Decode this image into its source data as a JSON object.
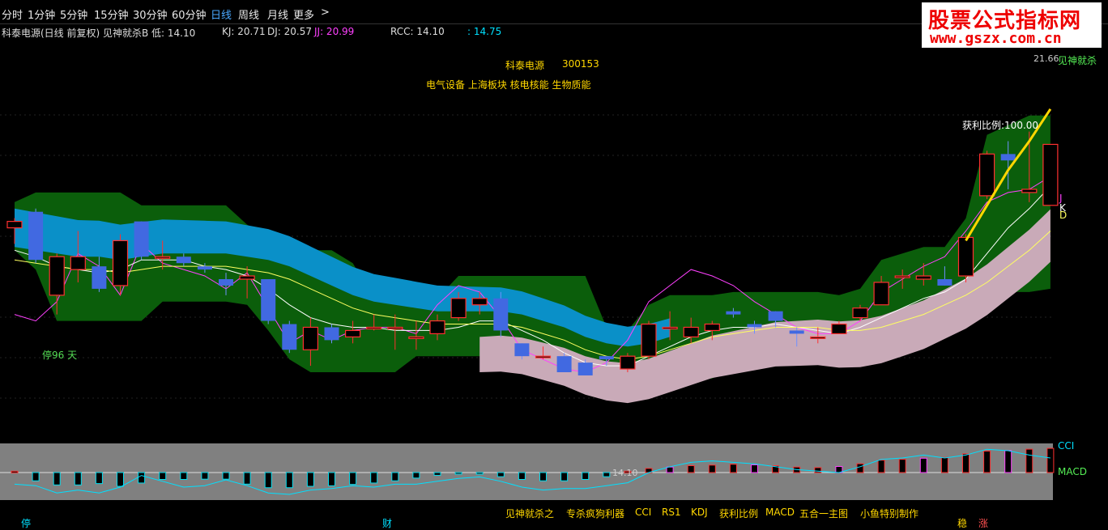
{
  "periods": [
    "分时",
    "1分钟",
    "5分钟",
    "15分钟",
    "30分钟",
    "60分钟",
    "日线",
    "周线",
    "月线",
    "更多"
  ],
  "active_period": "日线",
  "more_arrow": ">",
  "info": {
    "title": "科泰电源(日线 前复权) 见神就杀B 低: 14.10",
    "kj": "KJ: 20.71",
    "dj": "DJ: 20.57",
    "jj": "JJ: 20.99",
    "rcc": "RCC: 14.10",
    "extra": ": 14.75"
  },
  "logo": {
    "line1": "股票公式指标网",
    "line2": "www.gszx.com.cn"
  },
  "stock": {
    "name": "科泰电源",
    "code": "300153",
    "sectors": "电气设备 上海板块 核电核能 生物质能"
  },
  "annotations": {
    "ting": "停96 天",
    "profit": "获利比例:100.00",
    "high": "21.66",
    "low": "14.10",
    "jsjs": "见神就杀",
    "j_label": "J",
    "k_label": "K",
    "d_label": "D",
    "cci_label": "CCI",
    "macd_label": "MACD",
    "bottom_ting": "停",
    "bottom_cai": "财",
    "bottom_wen": "稳",
    "bottom_zhang": "涨"
  },
  "legend": [
    "见神就杀之",
    "专杀疯狗利器",
    "CCI",
    "RS1",
    "KDJ",
    "获利比例",
    "MACD",
    "五合一主图",
    "小鱼特别制作"
  ],
  "colors": {
    "up": "#ff3030",
    "down": "#4169e1",
    "green_band": "#0b5e0b",
    "blue_band": "#0a90c8",
    "pink_band": "#c9aab8",
    "gray_panel": "#808080",
    "accent": "#ffd700"
  },
  "chart_data": {
    "type": "candlestick",
    "xlim": [
      0,
      51
    ],
    "ylim": [
      13.0,
      22.2
    ],
    "candles": [
      {
        "i": 0,
        "o": 18.7,
        "h": 19.0,
        "l": 18.2,
        "c": 18.9
      },
      {
        "i": 1,
        "o": 19.2,
        "h": 19.3,
        "l": 17.6,
        "c": 17.7
      },
      {
        "i": 2,
        "o": 16.6,
        "h": 17.9,
        "l": 16.0,
        "c": 17.8
      },
      {
        "i": 3,
        "o": 17.4,
        "h": 18.6,
        "l": 17.0,
        "c": 17.8
      },
      {
        "i": 4,
        "o": 17.5,
        "h": 17.8,
        "l": 16.7,
        "c": 16.8
      },
      {
        "i": 5,
        "o": 16.9,
        "h": 18.5,
        "l": 16.6,
        "c": 18.3
      },
      {
        "i": 6,
        "o": 18.9,
        "h": 18.9,
        "l": 17.7,
        "c": 17.8
      },
      {
        "i": 7,
        "o": 17.8,
        "h": 18.3,
        "l": 17.4,
        "c": 17.8
      },
      {
        "i": 8,
        "o": 17.8,
        "h": 17.9,
        "l": 17.5,
        "c": 17.6
      },
      {
        "i": 9,
        "o": 17.5,
        "h": 17.6,
        "l": 17.3,
        "c": 17.4
      },
      {
        "i": 10,
        "o": 17.1,
        "h": 17.3,
        "l": 16.6,
        "c": 16.9
      },
      {
        "i": 11,
        "o": 17.1,
        "h": 17.5,
        "l": 16.5,
        "c": 17.2
      },
      {
        "i": 12,
        "o": 17.1,
        "h": 17.1,
        "l": 15.7,
        "c": 15.8
      },
      {
        "i": 13,
        "o": 15.7,
        "h": 15.8,
        "l": 14.8,
        "c": 14.9
      },
      {
        "i": 14,
        "o": 14.9,
        "h": 15.9,
        "l": 14.4,
        "c": 15.6
      },
      {
        "i": 15,
        "o": 15.6,
        "h": 15.7,
        "l": 15.1,
        "c": 15.2
      },
      {
        "i": 16,
        "o": 15.3,
        "h": 15.8,
        "l": 15.1,
        "c": 15.5
      },
      {
        "i": 17,
        "o": 15.6,
        "h": 16.0,
        "l": 15.5,
        "c": 15.6
      },
      {
        "i": 18,
        "o": 15.6,
        "h": 16.0,
        "l": 14.9,
        "c": 15.6
      },
      {
        "i": 19,
        "o": 15.3,
        "h": 15.8,
        "l": 14.9,
        "c": 15.3
      },
      {
        "i": 20,
        "o": 15.4,
        "h": 16.0,
        "l": 15.2,
        "c": 15.8
      },
      {
        "i": 21,
        "o": 15.9,
        "h": 16.7,
        "l": 15.8,
        "c": 16.5
      },
      {
        "i": 22,
        "o": 16.3,
        "h": 16.7,
        "l": 16.0,
        "c": 16.5
      },
      {
        "i": 23,
        "o": 16.5,
        "h": 16.7,
        "l": 15.3,
        "c": 15.5
      },
      {
        "i": 24,
        "o": 15.1,
        "h": 15.1,
        "l": 14.6,
        "c": 14.7
      },
      {
        "i": 25,
        "o": 14.7,
        "h": 15.0,
        "l": 14.6,
        "c": 14.7
      },
      {
        "i": 26,
        "o": 14.7,
        "h": 14.8,
        "l": 14.2,
        "c": 14.2
      },
      {
        "i": 27,
        "o": 14.5,
        "h": 14.6,
        "l": 14.1,
        "c": 14.1
      },
      {
        "i": 28,
        "o": 14.7,
        "h": 14.7,
        "l": 14.4,
        "c": 14.6
      },
      {
        "i": 29,
        "o": 14.3,
        "h": 14.8,
        "l": 14.2,
        "c": 14.7
      },
      {
        "i": 30,
        "o": 14.7,
        "h": 15.8,
        "l": 14.6,
        "c": 15.7
      },
      {
        "i": 31,
        "o": 15.6,
        "h": 16.1,
        "l": 15.2,
        "c": 15.6
      },
      {
        "i": 32,
        "o": 15.3,
        "h": 15.9,
        "l": 15.1,
        "c": 15.6
      },
      {
        "i": 33,
        "o": 15.5,
        "h": 15.8,
        "l": 15.2,
        "c": 15.7
      },
      {
        "i": 34,
        "o": 16.1,
        "h": 16.2,
        "l": 15.9,
        "c": 16.0
      },
      {
        "i": 35,
        "o": 15.7,
        "h": 15.8,
        "l": 15.4,
        "c": 15.6
      },
      {
        "i": 36,
        "o": 16.1,
        "h": 16.1,
        "l": 15.6,
        "c": 15.8
      },
      {
        "i": 37,
        "o": 15.5,
        "h": 15.6,
        "l": 15.0,
        "c": 15.4
      },
      {
        "i": 38,
        "o": 15.3,
        "h": 15.6,
        "l": 15.1,
        "c": 15.3
      },
      {
        "i": 39,
        "o": 15.4,
        "h": 15.8,
        "l": 15.4,
        "c": 15.7
      },
      {
        "i": 40,
        "o": 15.9,
        "h": 16.3,
        "l": 15.8,
        "c": 16.2
      },
      {
        "i": 41,
        "o": 16.3,
        "h": 17.2,
        "l": 16.3,
        "c": 17.0
      },
      {
        "i": 42,
        "o": 17.2,
        "h": 17.4,
        "l": 16.8,
        "c": 17.2
      },
      {
        "i": 43,
        "o": 17.1,
        "h": 17.6,
        "l": 16.9,
        "c": 17.2
      },
      {
        "i": 44,
        "o": 17.1,
        "h": 17.5,
        "l": 16.9,
        "c": 16.9
      },
      {
        "i": 45,
        "o": 17.2,
        "h": 18.5,
        "l": 17.0,
        "c": 18.4
      },
      {
        "i": 46,
        "o": 19.7,
        "h": 21.1,
        "l": 19.6,
        "c": 21.0
      },
      {
        "i": 47,
        "o": 21.0,
        "h": 21.4,
        "l": 19.9,
        "c": 20.8
      },
      {
        "i": 48,
        "o": 19.8,
        "h": 21.7,
        "l": 19.5,
        "c": 19.9
      },
      {
        "i": 49,
        "o": 19.4,
        "h": 21.3,
        "l": 19.4,
        "c": 21.3
      }
    ],
    "ma_short": [
      18.0,
      17.8,
      17.5,
      17.4,
      17.3,
      17.4,
      17.7,
      17.7,
      17.7,
      17.5,
      17.4,
      17.2,
      16.8,
      16.3,
      15.9,
      15.7,
      15.6,
      15.6,
      15.5,
      15.5,
      15.5,
      15.6,
      15.8,
      15.8,
      15.5,
      15.2,
      14.8,
      14.5,
      14.4,
      14.4,
      14.7,
      15.0,
      15.3,
      15.5,
      15.6,
      15.6,
      15.7,
      15.6,
      15.5,
      15.4,
      15.6,
      15.9,
      16.2,
      16.5,
      16.7,
      17.1,
      17.9,
      18.7,
      19.3,
      20.0
    ],
    "ma_long": [
      17.7,
      17.6,
      17.5,
      17.4,
      17.4,
      17.3,
      17.4,
      17.5,
      17.5,
      17.5,
      17.5,
      17.4,
      17.3,
      17.1,
      16.8,
      16.5,
      16.2,
      16.0,
      15.9,
      15.8,
      15.7,
      15.7,
      15.7,
      15.7,
      15.6,
      15.4,
      15.2,
      14.9,
      14.7,
      14.6,
      14.7,
      14.9,
      15.1,
      15.3,
      15.4,
      15.5,
      15.6,
      15.6,
      15.6,
      15.5,
      15.5,
      15.6,
      15.8,
      16.0,
      16.3,
      16.6,
      17.0,
      17.5,
      18.0,
      18.6
    ],
    "j_line": [
      16.0,
      15.8,
      16.4,
      17.9,
      17.5,
      16.6,
      18.2,
      17.6,
      17.4,
      17.2,
      16.8,
      17.3,
      16.2,
      15.1,
      15.5,
      15.2,
      15.5,
      15.6,
      15.6,
      15.4,
      16.3,
      16.9,
      16.7,
      15.9,
      14.9,
      14.6,
      14.3,
      14.2,
      14.5,
      15.2,
      16.4,
      16.9,
      17.4,
      17.2,
      16.9,
      16.4,
      16.0,
      15.6,
      15.4,
      15.4,
      15.8,
      16.7,
      17.1,
      17.5,
      17.8,
      18.6,
      19.5,
      19.8,
      19.9,
      20.3
    ],
    "cci": [
      -80,
      -90,
      -140,
      -120,
      -140,
      -100,
      -20,
      -60,
      -100,
      -90,
      -50,
      -90,
      -140,
      -150,
      -120,
      -110,
      -90,
      -100,
      -80,
      -80,
      -60,
      -40,
      -30,
      -60,
      -100,
      -120,
      -110,
      -110,
      -90,
      -70,
      0,
      40,
      70,
      80,
      70,
      60,
      40,
      20,
      10,
      0,
      40,
      90,
      100,
      120,
      100,
      120,
      160,
      150,
      120,
      100
    ],
    "macd": [
      0.05,
      -0.3,
      -0.45,
      -0.45,
      -0.4,
      -0.5,
      -0.38,
      -0.25,
      -0.25,
      -0.24,
      -0.24,
      -0.42,
      -0.55,
      -0.55,
      -0.5,
      -0.48,
      -0.43,
      -0.38,
      -0.3,
      -0.2,
      -0.1,
      0,
      -0.02,
      -0.15,
      -0.25,
      -0.3,
      -0.3,
      -0.25,
      -0.15,
      0.05,
      0.15,
      0.2,
      0.25,
      0.27,
      0.3,
      0.28,
      0.25,
      0.2,
      0.18,
      0.22,
      0.32,
      0.45,
      0.48,
      0.52,
      0.55,
      0.68,
      0.78,
      0.8,
      0.85,
      0.88
    ]
  }
}
